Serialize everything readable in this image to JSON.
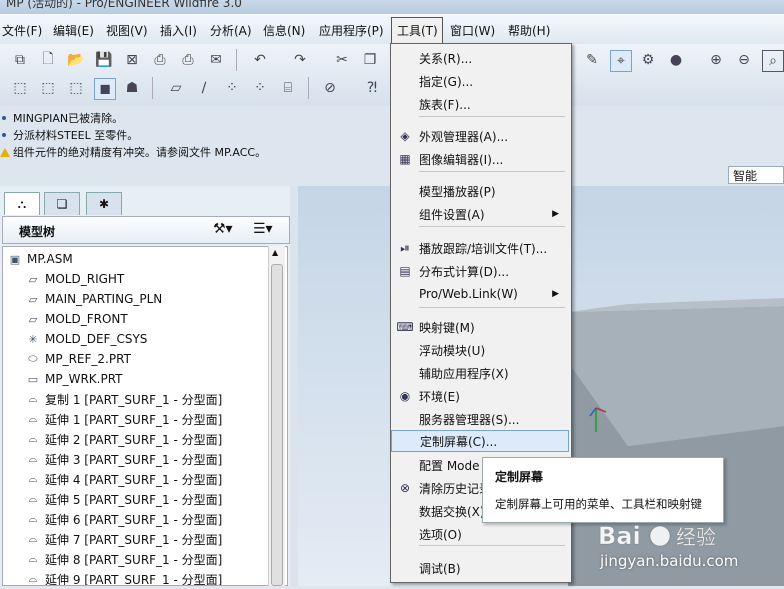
{
  "title": "MP (活动的) - Pro/ENGINEER Wildfire 3.0",
  "menubar": {
    "items": [
      "文件(F)",
      "编辑(E)",
      "视图(V)",
      "插入(I)",
      "分析(A)",
      "信息(N)",
      "应用程序(P)",
      "工具(T)",
      "窗口(W)",
      "帮助(H)"
    ]
  },
  "messages": [
    {
      "text": "MINGPIAN已被清除。",
      "kind": "info"
    },
    {
      "text": "分派材料STEEL 至零件。",
      "kind": "info"
    },
    {
      "text": "组件元件的绝对精度有冲突。请参阅文件 MP.ACC。",
      "kind": "warning"
    }
  ],
  "filter_value": "智能",
  "tree": {
    "title": "模型树",
    "items": [
      {
        "label": "MP.ASM",
        "icon": "assembly-icon"
      },
      {
        "label": "MOLD_RIGHT",
        "icon": "datum-plane-icon"
      },
      {
        "label": "MAIN_PARTING_PLN",
        "icon": "datum-plane-icon"
      },
      {
        "label": "MOLD_FRONT",
        "icon": "datum-plane-icon"
      },
      {
        "label": "MOLD_DEF_CSYS",
        "icon": "csys-icon"
      },
      {
        "label": "MP_REF_2.PRT",
        "icon": "part-icon"
      },
      {
        "label": "MP_WRK.PRT",
        "icon": "workpiece-icon"
      },
      {
        "label": "复制 1 [PART_SURF_1 - 分型面]",
        "icon": "surface-icon"
      },
      {
        "label": "延伸 1 [PART_SURF_1 - 分型面]",
        "icon": "surface-icon"
      },
      {
        "label": "延伸 2 [PART_SURF_1 - 分型面]",
        "icon": "surface-icon"
      },
      {
        "label": "延伸 3 [PART_SURF_1 - 分型面]",
        "icon": "surface-icon"
      },
      {
        "label": "延伸 4 [PART_SURF_1 - 分型面]",
        "icon": "surface-icon"
      },
      {
        "label": "延伸 5 [PART_SURF_1 - 分型面]",
        "icon": "surface-icon"
      },
      {
        "label": "延伸 6 [PART_SURF_1 - 分型面]",
        "icon": "surface-icon"
      },
      {
        "label": "延伸 7 [PART_SURF_1 - 分型面]",
        "icon": "surface-icon"
      },
      {
        "label": "延伸 8 [PART_SURF_1 - 分型面]",
        "icon": "surface-icon"
      },
      {
        "label": "延伸 9 [PART_SURF_1 - 分型面]",
        "icon": "surface-icon"
      }
    ]
  },
  "tools_menu": {
    "items": [
      {
        "label": "关系(R)..."
      },
      {
        "label": "指定(G)..."
      },
      {
        "label": "族表(F)..."
      },
      {
        "label": "外观管理器(A)...",
        "icon": "appearance-icon"
      },
      {
        "label": "图像编辑器(I)...",
        "icon": "image-editor-icon"
      },
      {
        "label": "模型播放器(P)"
      },
      {
        "label": "组件设置(A)",
        "submenu": true
      },
      {
        "label": "播放跟踪/培训文件(T)...",
        "icon": "trail-icon"
      },
      {
        "label": "分布式计算(D)...",
        "icon": "distributed-icon"
      },
      {
        "label": "Pro/Web.Link(W)",
        "submenu": true
      },
      {
        "label": "映射键(M)",
        "icon": "mapkey-icon"
      },
      {
        "label": "浮动模块(U)"
      },
      {
        "label": "辅助应用程序(X)"
      },
      {
        "label": "环境(E)",
        "icon": "environment-icon"
      },
      {
        "label": "服务器管理器(S)..."
      },
      {
        "label": "定制屏幕(C)...",
        "highlighted": true
      },
      {
        "label": "配置 Mode"
      },
      {
        "label": "清除历史记录",
        "icon": "clear-history-icon"
      },
      {
        "label": "数据交换(X)"
      },
      {
        "label": "选项(O)"
      },
      {
        "label": "调试(B)"
      }
    ]
  },
  "tooltip": {
    "title": "定制屏幕",
    "text": "定制屏幕上可用的菜单、工具栏和映射键"
  },
  "watermark": {
    "brand": "Bai",
    "suffix": "经验",
    "url": "jingyan.baidu.com"
  },
  "colors": {
    "highlight": "#dceaf9",
    "warning": "#e5b000",
    "model": "#9aa5ae"
  }
}
